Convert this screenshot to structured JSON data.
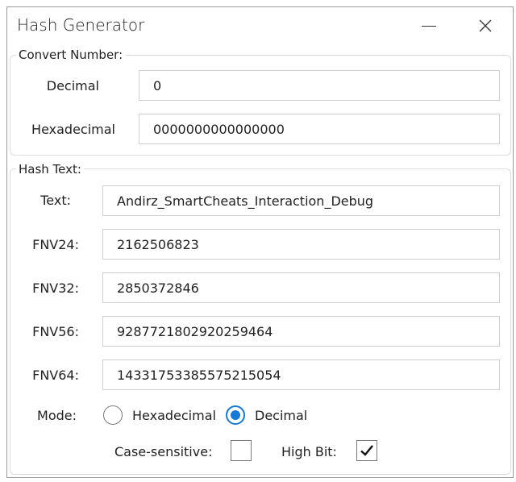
{
  "window": {
    "title": "Hash Generator"
  },
  "convert": {
    "group_label": "Convert Number:",
    "decimal_label": "Decimal",
    "decimal_value": "0",
    "hex_label": "Hexadecimal",
    "hex_value": "0000000000000000"
  },
  "hash": {
    "group_label": "Hash Text:",
    "text_label": "Text:",
    "text_value": "Andirz_SmartCheats_Interaction_Debug",
    "fnv24_label": "FNV24:",
    "fnv24_value": "2162506823",
    "fnv32_label": "FNV32:",
    "fnv32_value": "2850372846",
    "fnv56_label": "FNV56:",
    "fnv56_value": "9287721802920259464",
    "fnv64_label": "FNV64:",
    "fnv64_value": "14331753385575215054",
    "mode_label": "Mode:",
    "mode_options": [
      "Hexadecimal",
      "Decimal"
    ],
    "mode_selected": "Decimal",
    "case_label": "Case-sensitive:",
    "case_checked": false,
    "highbit_label": "High Bit:",
    "highbit_checked": true
  },
  "colors": {
    "accent": "#1679d6",
    "border": "#cfcfcf"
  }
}
